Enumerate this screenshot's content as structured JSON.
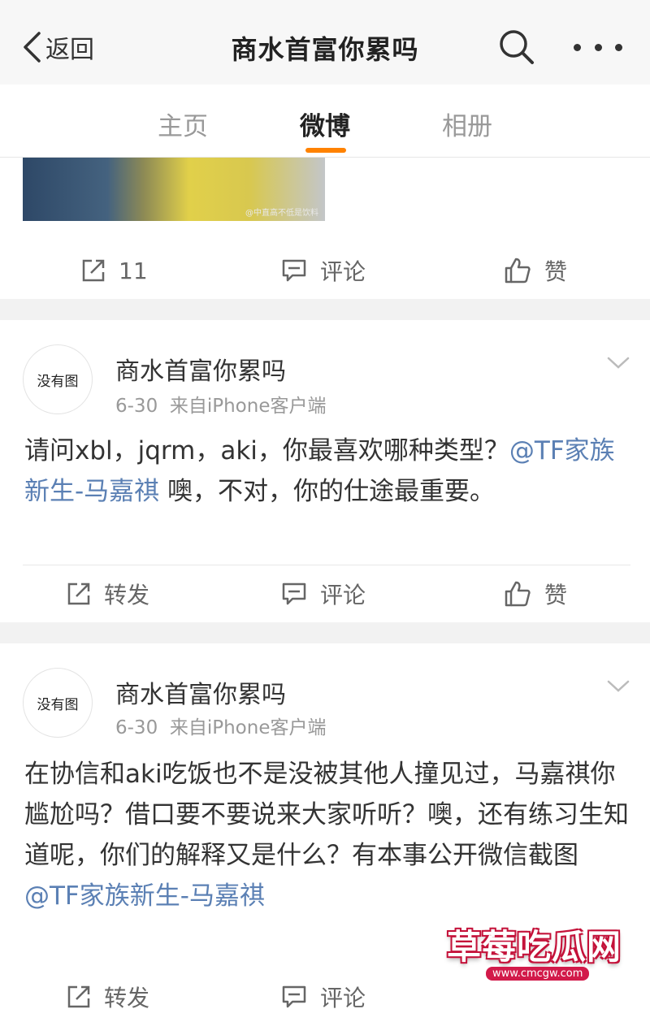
{
  "navbar": {
    "back_label": "返回",
    "title": "商水首富你累吗"
  },
  "tabs": [
    {
      "label": "主页"
    },
    {
      "label": "微博"
    },
    {
      "label": "相册"
    }
  ],
  "colors": {
    "accent": "#ff8200",
    "mention": "#5b80b4",
    "badge": "#d21a4a"
  },
  "post0": {
    "image_watermark": "@中直高不低是饮料",
    "actions": {
      "repost_label": "11",
      "comment_label": "评论",
      "like_label": "赞"
    }
  },
  "posts": [
    {
      "avatar_text": "没有图",
      "username": "商水首富你累吗",
      "date": "6-30",
      "source": "来自iPhone客户端",
      "text_before": "请问xbl，jqrm，aki，你最喜欢哪种类型？",
      "mention": "@TF家族新生-马嘉祺",
      "text_after": " 噢，不对，你的仕途最重要。",
      "actions": {
        "repost_label": "转发",
        "comment_label": "评论",
        "like_label": "赞"
      }
    },
    {
      "avatar_text": "没有图",
      "username": "商水首富你累吗",
      "date": "6-30",
      "source": "来自iPhone客户端",
      "text_before": "在协信和aki吃饭也不是没被其他人撞见过，马嘉祺你尴尬吗？借口要不要说来大家听听？噢，还有练习生知道呢，你们的解释又是什么？有本事公开微信截图",
      "mention": "@TF家族新生-马嘉祺",
      "text_after": "",
      "actions": {
        "repost_label": "转发",
        "comment_label": "评论"
      }
    }
  ],
  "watermark": {
    "title": "草莓吃瓜网",
    "url": "www.cmcgw.com"
  }
}
